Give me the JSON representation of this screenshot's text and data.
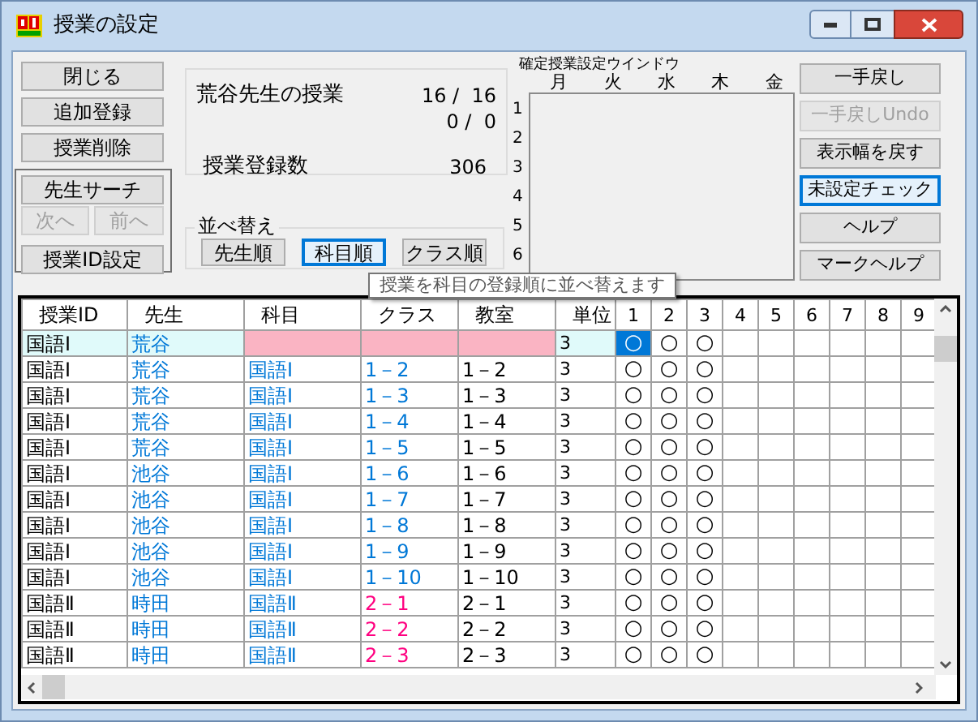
{
  "window": {
    "title": "授業の設定"
  },
  "left_buttons": [
    {
      "label": "閉じる",
      "disabled": false
    },
    {
      "label": "追加登録",
      "disabled": false
    },
    {
      "label": "授業削除",
      "disabled": false
    }
  ],
  "search_group": {
    "search": {
      "label": "先生サーチ",
      "disabled": false
    },
    "next": {
      "label": "次へ",
      "disabled": true
    },
    "prev": {
      "label": "前へ",
      "disabled": true
    },
    "id_setting": {
      "label": "授業ID設定",
      "disabled": false
    }
  },
  "info": {
    "teacher_lessons": "荒谷先生の授業",
    "count_1": "16 /  16",
    "count_2": "0 /  0",
    "registered_label": "授業登録数",
    "registered_count": "306"
  },
  "sort": {
    "label": "並べ替え",
    "buttons": [
      {
        "label": "先生順",
        "selected": false
      },
      {
        "label": "科目順",
        "selected": true
      },
      {
        "label": "クラス順",
        "selected": false
      }
    ]
  },
  "timetable": {
    "title": "確定授業設定ウインドウ",
    "days": [
      "月",
      "火",
      "水",
      "木",
      "金"
    ],
    "periods": [
      "1",
      "2",
      "3",
      "4",
      "5",
      "6"
    ]
  },
  "right_buttons": [
    {
      "label": "一手戻し",
      "disabled": false,
      "focused": false
    },
    {
      "label": "一手戻しUndo",
      "disabled": true,
      "focused": false
    },
    {
      "label": "表示幅を戻す",
      "disabled": false,
      "focused": false
    },
    {
      "label": "未設定チェック",
      "disabled": false,
      "focused": true
    },
    {
      "label": "ヘルプ",
      "disabled": false,
      "focused": false
    },
    {
      "label": "マークヘルプ",
      "disabled": false,
      "focused": false
    }
  ],
  "tooltip": "授業を科目の登録順に並べ替えます",
  "table": {
    "columns": [
      "授業ID",
      "先生",
      "科目",
      "クラス",
      "教室",
      "単位",
      "1",
      "2",
      "3",
      "4",
      "5",
      "6",
      "7",
      "8",
      "9"
    ],
    "rows": [
      {
        "selected": true,
        "id": "国語Ⅰ",
        "teacher": "荒谷",
        "units": "3",
        "marks": [
          "○",
          "○",
          "○"
        ]
      },
      {
        "selected": false,
        "id": "国語Ⅰ",
        "teacher": "荒谷",
        "subject": "国語Ⅰ",
        "class": {
          "text": "1－2",
          "color": "#0078d7"
        },
        "room": "1－2",
        "units": "3",
        "marks": [
          "○",
          "○",
          "○"
        ]
      },
      {
        "selected": false,
        "id": "国語Ⅰ",
        "teacher": "荒谷",
        "subject": "国語Ⅰ",
        "class": {
          "text": "1－3",
          "color": "#0078d7"
        },
        "room": "1－3",
        "units": "3",
        "marks": [
          "○",
          "○",
          "○"
        ]
      },
      {
        "selected": false,
        "id": "国語Ⅰ",
        "teacher": "荒谷",
        "subject": "国語Ⅰ",
        "class": {
          "text": "1－4",
          "color": "#0078d7"
        },
        "room": "1－4",
        "units": "3",
        "marks": [
          "○",
          "○",
          "○"
        ]
      },
      {
        "selected": false,
        "id": "国語Ⅰ",
        "teacher": "荒谷",
        "subject": "国語Ⅰ",
        "class": {
          "text": "1－5",
          "color": "#0078d7"
        },
        "room": "1－5",
        "units": "3",
        "marks": [
          "○",
          "○",
          "○"
        ]
      },
      {
        "selected": false,
        "id": "国語Ⅰ",
        "teacher": "池谷",
        "subject": "国語Ⅰ",
        "class": {
          "text": "1－6",
          "color": "#0078d7"
        },
        "room": "1－6",
        "units": "3",
        "marks": [
          "○",
          "○",
          "○"
        ]
      },
      {
        "selected": false,
        "id": "国語Ⅰ",
        "teacher": "池谷",
        "subject": "国語Ⅰ",
        "class": {
          "text": "1－7",
          "color": "#0078d7"
        },
        "room": "1－7",
        "units": "3",
        "marks": [
          "○",
          "○",
          "○"
        ]
      },
      {
        "selected": false,
        "id": "国語Ⅰ",
        "teacher": "池谷",
        "subject": "国語Ⅰ",
        "class": {
          "text": "1－8",
          "color": "#0078d7"
        },
        "room": "1－8",
        "units": "3",
        "marks": [
          "○",
          "○",
          "○"
        ]
      },
      {
        "selected": false,
        "id": "国語Ⅰ",
        "teacher": "池谷",
        "subject": "国語Ⅰ",
        "class": {
          "text": "1－9",
          "color": "#0078d7"
        },
        "room": "1－9",
        "units": "3",
        "marks": [
          "○",
          "○",
          "○"
        ]
      },
      {
        "selected": false,
        "id": "国語Ⅰ",
        "teacher": "池谷",
        "subject": "国語Ⅰ",
        "class": {
          "text": "1－10",
          "color": "#0078d7"
        },
        "room": "1－10",
        "units": "3",
        "marks": [
          "○",
          "○",
          "○"
        ]
      },
      {
        "selected": false,
        "id": "国語Ⅱ",
        "teacher": "時田",
        "subject": "国語Ⅱ",
        "class": {
          "text": "2－1",
          "color": "#ff0080"
        },
        "room": "2－1",
        "units": "3",
        "marks": [
          "○",
          "○",
          "○"
        ]
      },
      {
        "selected": false,
        "id": "国語Ⅱ",
        "teacher": "時田",
        "subject": "国語Ⅱ",
        "class": {
          "text": "2－2",
          "color": "#ff0080"
        },
        "room": "2－2",
        "units": "3",
        "marks": [
          "○",
          "○",
          "○"
        ]
      },
      {
        "selected": false,
        "id": "国語Ⅱ",
        "teacher": "時田",
        "subject": "国語Ⅱ",
        "class": {
          "text": "2－3",
          "color": "#ff0080"
        },
        "room": "2－3",
        "units": "3",
        "marks": [
          "○",
          "○",
          "○"
        ]
      }
    ]
  }
}
